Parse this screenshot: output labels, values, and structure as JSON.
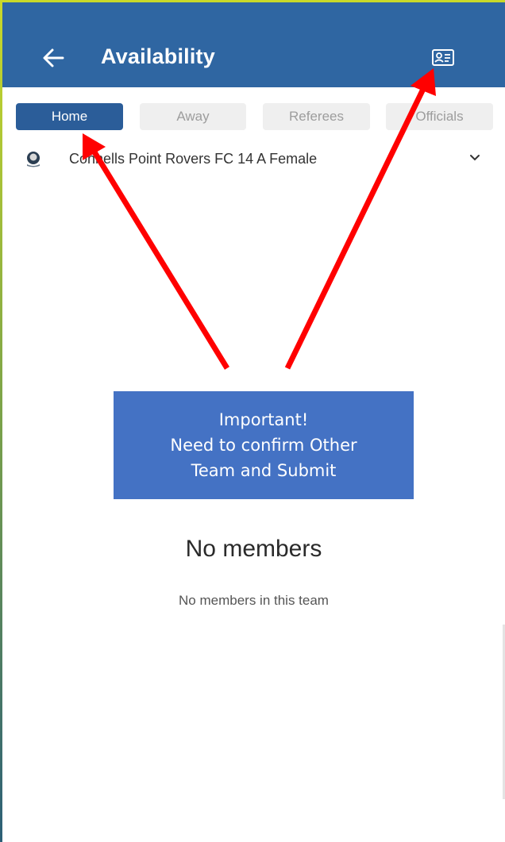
{
  "app": {
    "title": "Availability",
    "back_icon": "arrow-left-icon",
    "contact_icon": "contact-card-icon",
    "header_color": "#2f66a2"
  },
  "tabs": [
    {
      "label": "Home",
      "active": true
    },
    {
      "label": "Away",
      "active": false
    },
    {
      "label": "Referees",
      "active": false
    },
    {
      "label": "Officials",
      "active": false
    }
  ],
  "team": {
    "name": "Connells Point Rovers FC 14 A Female",
    "logo_icon": "club-crest-icon",
    "dropdown_icon": "chevron-down-icon"
  },
  "empty_state": {
    "title": "No members",
    "subtitle": "No members in this team"
  },
  "annotation": {
    "line1": "Important!",
    "line2": "Need to confirm Other",
    "line3": "Team and Submit",
    "box_color": "#4472c4",
    "arrow_color": "#ff0000"
  }
}
